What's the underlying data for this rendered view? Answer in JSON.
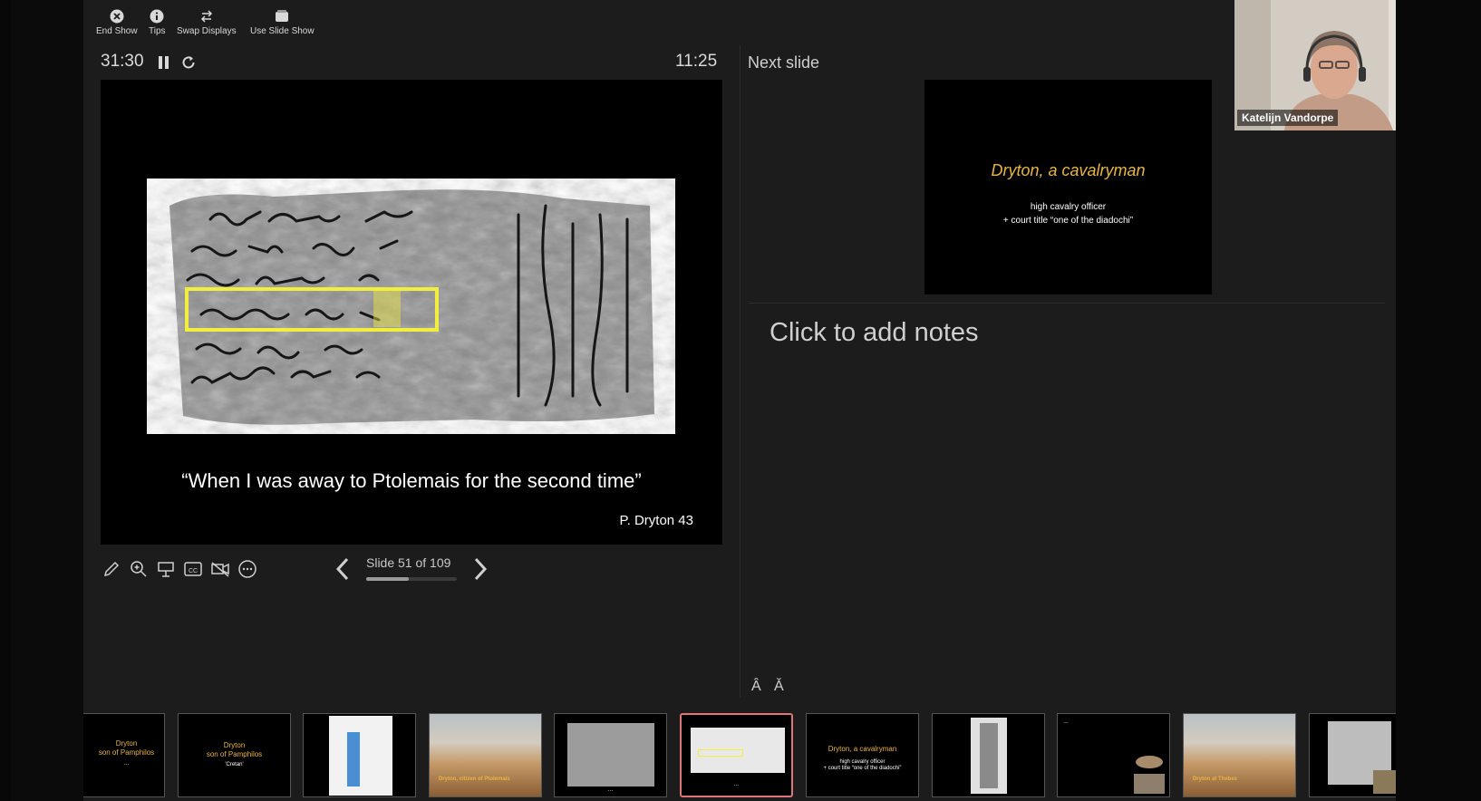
{
  "toolbar": {
    "items": [
      {
        "label": "End Show",
        "icon": "close-circle-icon"
      },
      {
        "label": "Tips",
        "icon": "info-icon"
      },
      {
        "label": "Swap Displays",
        "icon": "swap-icon"
      },
      {
        "label": "Use Slide Show",
        "icon": "slideshow-icon"
      }
    ]
  },
  "timer": {
    "elapsed": "31:30",
    "clock": "11:25"
  },
  "current_slide": {
    "quote": "“When I was away to Ptolemais for the second time”",
    "reference": "P. Dryton 43"
  },
  "navigation": {
    "counter": "Slide 51 of 109",
    "current": 51,
    "total": 109
  },
  "next_slide": {
    "label": "Next slide",
    "title": "Dryton, a cavalryman",
    "line1": "high cavalry officer",
    "line2": "+ court title “one of the diadochi”"
  },
  "notes": {
    "placeholder": "Click to add notes"
  },
  "video": {
    "participant": "Katelijn Vandorpe"
  },
  "filmstrip": {
    "thumbs": [
      {
        "title": "Dryton\nson of Pamphilos"
      },
      {
        "title": "Dryton\nson of Pamphilos",
        "sub": "'Cretan'"
      },
      {
        "kind": "map"
      },
      {
        "kind": "desert",
        "caption": "Dryton, citizen of Ptolemais"
      },
      {
        "kind": "papyrus"
      },
      {
        "kind": "papyrus-active"
      },
      {
        "title": "Dryton, a cavalryman",
        "sub": "high cavalry officer\n+ court title “one of the diadochi”"
      },
      {
        "kind": "papyrus-tall"
      },
      {
        "kind": "text-images"
      },
      {
        "kind": "desert",
        "caption": "Dryton at Thebes"
      },
      {
        "kind": "papyrus"
      }
    ]
  },
  "colors": {
    "accent": "#e9b441",
    "active_border": "#e07575",
    "highlight": "#f2ee3c"
  }
}
